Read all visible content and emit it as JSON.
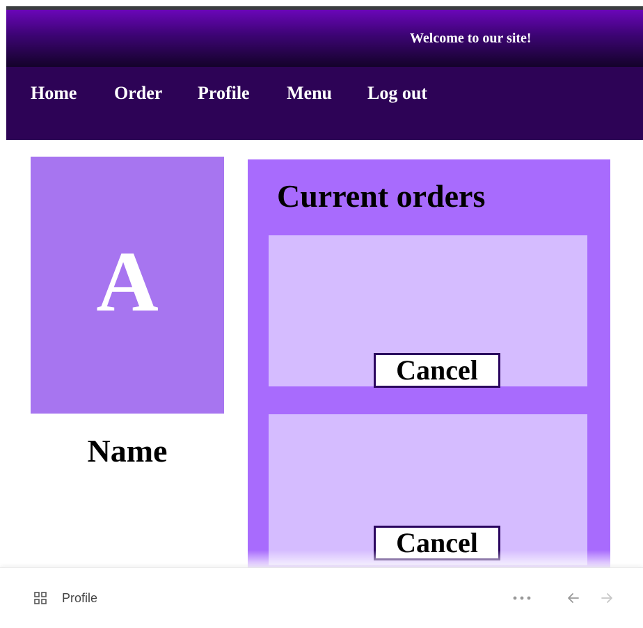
{
  "header": {
    "welcome": "Welcome to our site!"
  },
  "nav": {
    "items": [
      {
        "label": "Home"
      },
      {
        "label": "Order"
      },
      {
        "label": "Profile"
      },
      {
        "label": "Menu"
      },
      {
        "label": "Log out"
      }
    ]
  },
  "profile": {
    "avatar_letter": "A",
    "name": "Name"
  },
  "orders": {
    "title": "Current orders",
    "items": [
      {
        "cancel_label": "Cancel"
      },
      {
        "cancel_label": "Cancel"
      }
    ]
  },
  "footer": {
    "page_label": "Profile",
    "grid_icon": "grid-icon",
    "more_icon": "more-horizontal-icon",
    "back_icon": "arrow-left-icon",
    "forward_icon": "arrow-right-icon"
  },
  "colors": {
    "header_gradient_top": "#6a06b8",
    "nav_background": "#2d0356",
    "avatar_background": "#a775f0",
    "orders_panel": "#a86bfd",
    "order_card": "#d5bcff",
    "button_border": "#2b0660"
  }
}
